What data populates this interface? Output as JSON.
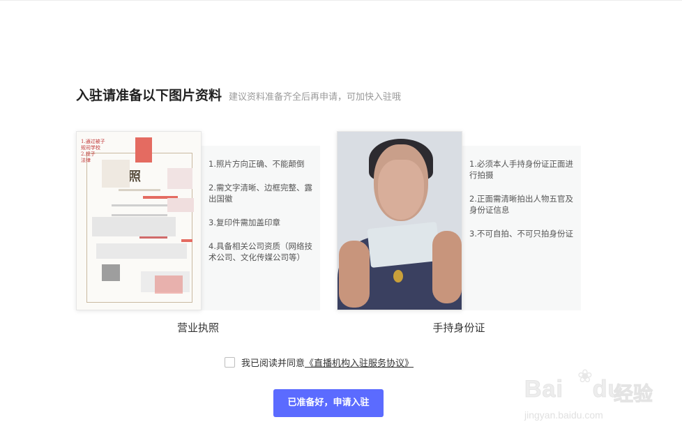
{
  "header": {
    "title": "入驻请准备以下图片资料",
    "subtitle": "建议资料准备齐全后再申请，可加快入驻哦"
  },
  "license": {
    "caption": "营业执照",
    "image_title": "执照",
    "tips": [
      "1.照片方向正确、不能颠倒",
      "2.需文字清晰、边框完整、露出国徽",
      "3.复印件需加盖印章",
      "4.具备相关公司资质（网络技术公司、文化传媒公司等）"
    ]
  },
  "id_photo": {
    "caption": "手持身份证",
    "tips": [
      "1.必须本人手持身份证正面进行拍摄",
      "2.正面需清晰拍出人物五官及身份证信息",
      "3.不可自拍、不可只拍身份证"
    ]
  },
  "agreement": {
    "checked": false,
    "text": "我已阅读并同意",
    "link": "《直播机构入驻服务协议》"
  },
  "submit_label": "已准备好，申请入驻",
  "watermark": {
    "brand": "Bai",
    "brand_suffix": "du",
    "cn": "经验",
    "url": "jingyan.baidu.com"
  },
  "colors": {
    "accent": "#5b6bff",
    "tips_bg": "#f7f8f8",
    "subtitle": "#9a9a9a"
  }
}
